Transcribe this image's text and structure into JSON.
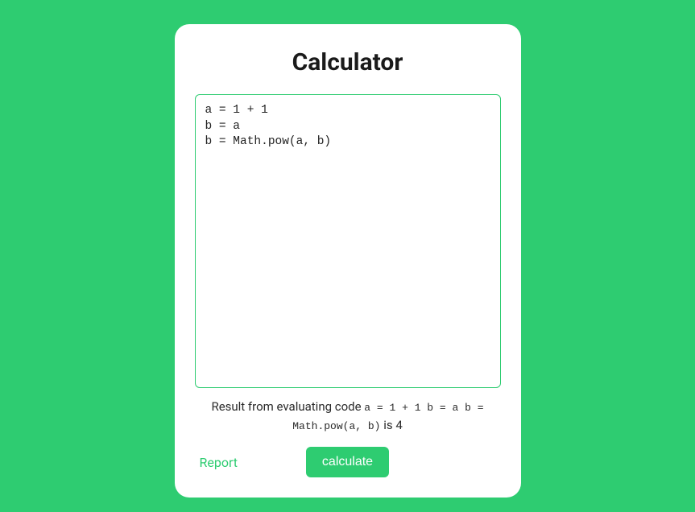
{
  "title": "Calculator",
  "code_input": "a = 1 + 1\nb = a\nb = Math.pow(a, b)",
  "result": {
    "prefix": "Result from evaluating code ",
    "code_echo": "a = 1 + 1 b = a b = Math.pow(a, b)",
    "middle": " is ",
    "value": "4"
  },
  "actions": {
    "report_label": "Report",
    "calculate_label": "calculate"
  },
  "colors": {
    "accent": "#2ecc71",
    "background": "#2ecc71",
    "card": "#ffffff"
  }
}
